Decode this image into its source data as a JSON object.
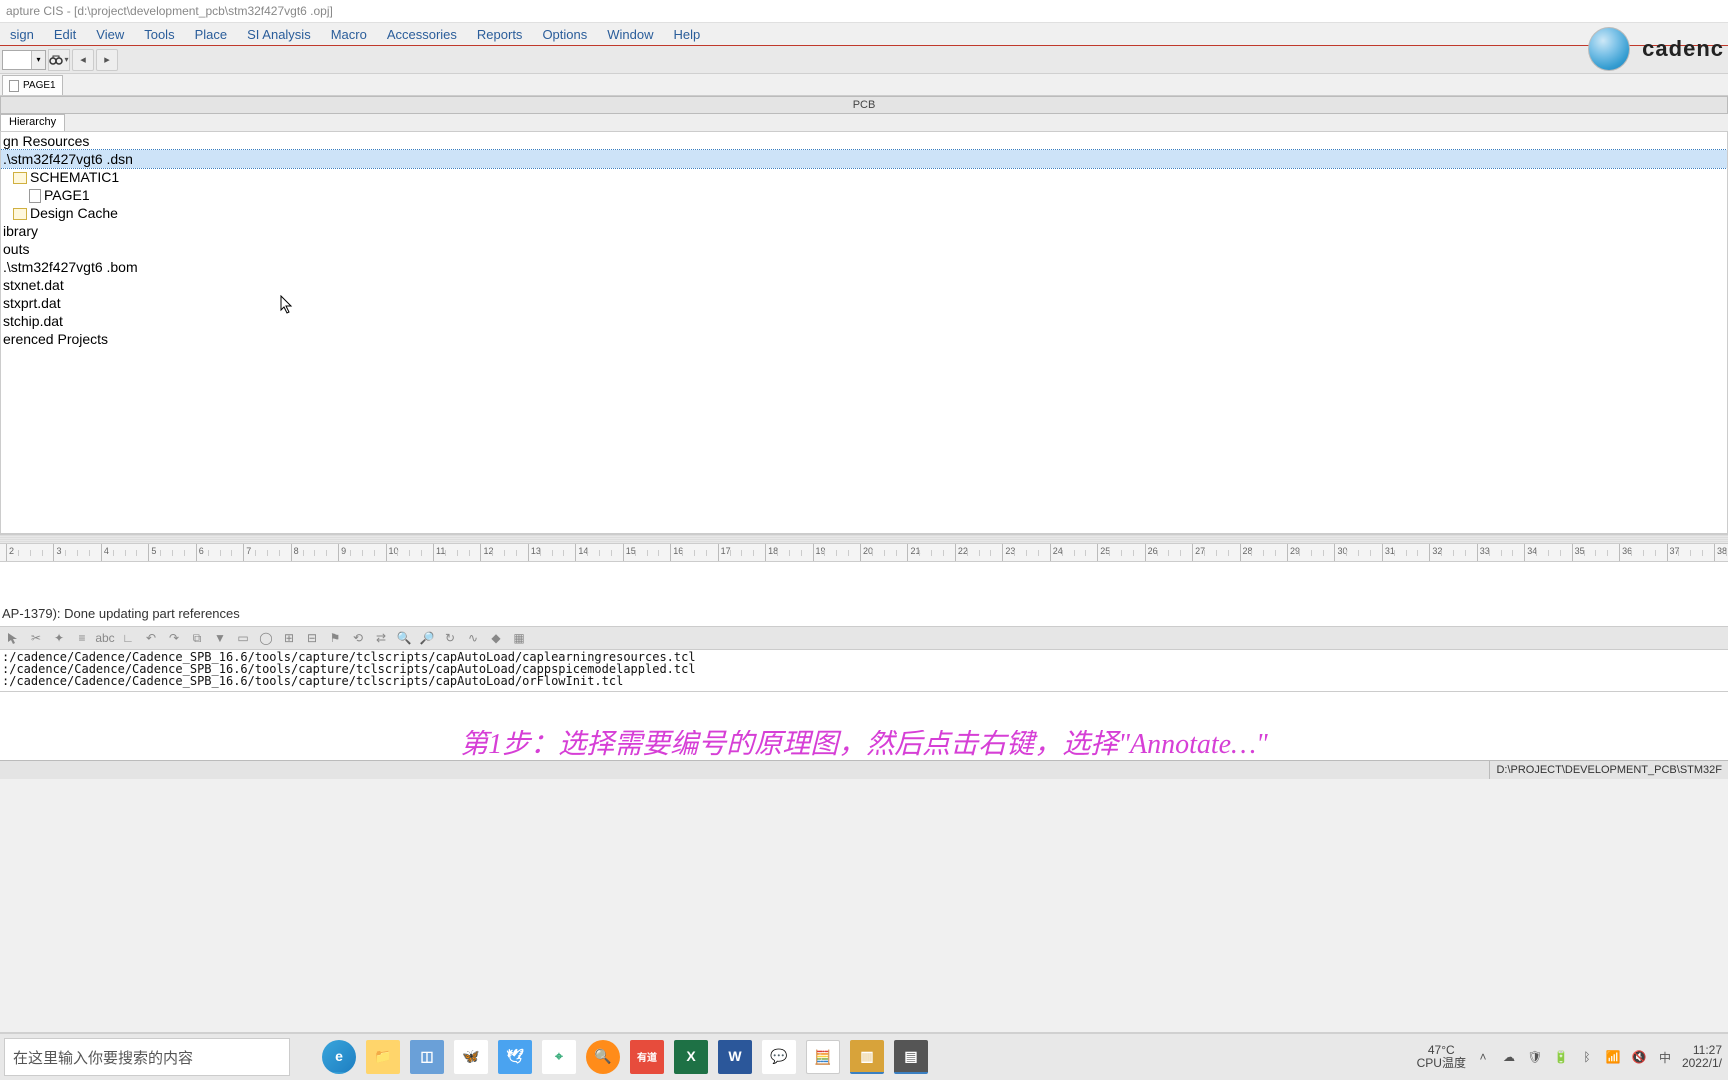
{
  "window": {
    "title": "apture CIS - [d:\\project\\development_pcb\\stm32f427vgt6 .opj]"
  },
  "brand": {
    "logo_text": "cadenc"
  },
  "menu": {
    "items": [
      "sign",
      "Edit",
      "View",
      "Tools",
      "Place",
      "SI Analysis",
      "Macro",
      "Accessories",
      "Reports",
      "Options",
      "Window",
      "Help"
    ]
  },
  "doc_tabs": {
    "page1": "PAGE1"
  },
  "pcb_header": "PCB",
  "hierarchy_tab": "Hierarchy",
  "tree": {
    "items": [
      {
        "text": "gn Resources",
        "indent": 0,
        "sel": false,
        "icon": null
      },
      {
        "text": ".\\stm32f427vgt6 .dsn",
        "indent": 0,
        "sel": true,
        "icon": null
      },
      {
        "text": "SCHEMATIC1",
        "indent": 1,
        "sel": false,
        "icon": "folder"
      },
      {
        "text": "PAGE1",
        "indent": 2,
        "sel": false,
        "icon": "page"
      },
      {
        "text": "Design Cache",
        "indent": 1,
        "sel": false,
        "icon": "folder"
      },
      {
        "text": "ibrary",
        "indent": 0,
        "sel": false,
        "icon": null
      },
      {
        "text": "outs",
        "indent": 0,
        "sel": false,
        "icon": null
      },
      {
        "text": ".\\stm32f427vgt6 .bom",
        "indent": 0,
        "sel": false,
        "icon": null
      },
      {
        "text": "stxnet.dat",
        "indent": 0,
        "sel": false,
        "icon": null
      },
      {
        "text": "stxprt.dat",
        "indent": 0,
        "sel": false,
        "icon": null
      },
      {
        "text": "stchip.dat",
        "indent": 0,
        "sel": false,
        "icon": null
      },
      {
        "text": "erenced Projects",
        "indent": 0,
        "sel": false,
        "icon": null
      }
    ]
  },
  "ruler": {
    "start": 2,
    "end": 38,
    "marks": [
      2,
      3,
      4,
      5,
      6,
      7,
      8,
      9,
      10,
      11,
      12,
      13,
      14,
      15,
      16,
      17,
      18,
      19,
      20,
      21,
      22,
      23,
      24,
      25,
      26,
      27,
      28,
      29,
      30,
      31,
      32,
      33,
      34,
      35,
      36,
      37,
      38
    ]
  },
  "log_message": "AP-1379): Done updating part references",
  "script_log": [
    ":/cadence/Cadence/Cadence_SPB_16.6/tools/capture/tclscripts/capAutoLoad/caplearningresources.tcl",
    ":/cadence/Cadence/Cadence_SPB_16.6/tools/capture/tclscripts/capAutoLoad/cappspicemodelappled.tcl",
    ":/cadence/Cadence/Cadence_SPB_16.6/tools/capture/tclscripts/capAutoLoad/orFlowInit.tcl"
  ],
  "annotation_text": "第1步：选择需要编号的原理图，然后点击右键，选择\"Annotate…\"",
  "status": {
    "path": "D:\\PROJECT\\DEVELOPMENT_PCB\\STM32F"
  },
  "taskbar": {
    "search_placeholder": "在这里输入你要搜索的内容",
    "weather_temp": "47°C",
    "weather_label": "CPU温度",
    "time": "11:27",
    "date": "2022/1/"
  }
}
